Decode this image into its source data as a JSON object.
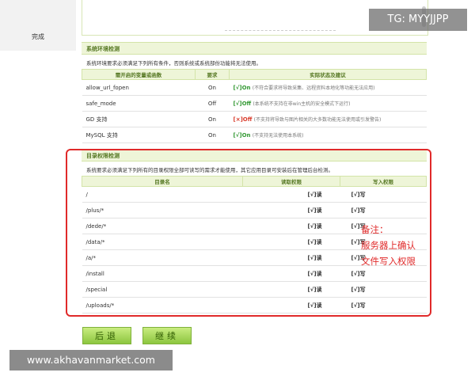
{
  "nav": {
    "done_label": "完成"
  },
  "env": {
    "title": "系统环境检测",
    "description": "系统环境要求必须满足下列所有条件，否则系统或系统部份功能将无法使用。",
    "headers": [
      "需开启的变量或函数",
      "要求",
      "实际状态及建议"
    ],
    "rows": [
      {
        "name": "allow_url_fopen",
        "req": "On",
        "status": "[√]On",
        "status_type": "ok",
        "note": "(不符合要求将导致采集、远程资料本地化等功能无法应用)"
      },
      {
        "name": "safe_mode",
        "req": "Off",
        "status": "[√]Off",
        "status_type": "ok",
        "note": "(本系统不支持在非win主机的安全模式下运行)"
      },
      {
        "name": "GD 支持",
        "req": "On",
        "status": "[×]Off",
        "status_type": "bad",
        "note": "(不支持将导致与图片相关的大多数功能无法使用或引发警告)"
      },
      {
        "name": "MySQL 支持",
        "req": "On",
        "status": "[√]On",
        "status_type": "ok",
        "note": "(不支持无法使用本系统)"
      }
    ]
  },
  "dirs": {
    "title": "目录权限检测",
    "description": "系统要求必须满足下列所有的目录权限全部可读写的需求才能使用，其它应用目录可安装后在管理后台检测。",
    "headers": [
      "目录名",
      "读取权限",
      "写入权限"
    ],
    "rows": [
      {
        "dir": "/",
        "read": "[√]读",
        "write": "[√]写"
      },
      {
        "dir": "/plus/*",
        "read": "[√]读",
        "write": "[√]写"
      },
      {
        "dir": "/dede/*",
        "read": "[√]读",
        "write": "[√]写"
      },
      {
        "dir": "/data/*",
        "read": "[√]读",
        "write": "[√]写"
      },
      {
        "dir": "/a/*",
        "read": "[√]读",
        "write": "[√]写"
      },
      {
        "dir": "/install",
        "read": "[√]读",
        "write": "[√]写"
      },
      {
        "dir": "/special",
        "read": "[√]读",
        "write": "[√]写"
      },
      {
        "dir": "/uploads/*",
        "read": "[√]读",
        "write": "[√]写"
      }
    ]
  },
  "annotation": {
    "line1": "备注：",
    "line2": "服务器上确认",
    "line3": "文件写入权限"
  },
  "buttons": {
    "back": "后退",
    "next": "继续"
  },
  "watermarks": {
    "tg": "TG: MYYJJPP",
    "site": "www.akhavanmarket.com"
  },
  "colors": {
    "accent_green": "#8cc63f",
    "header_bg": "#eef5d8",
    "ok": "#339933",
    "error": "#d93b2b",
    "annotation_red": "#e02a2a"
  }
}
